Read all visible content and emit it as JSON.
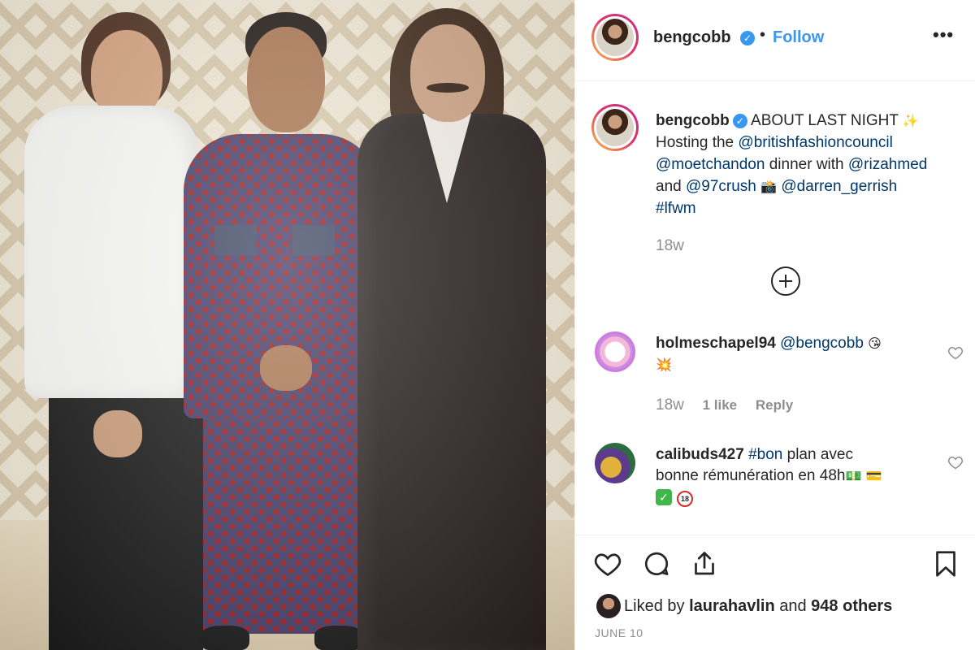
{
  "post": {
    "username": "bengcobb",
    "follow_label": "Follow",
    "more_label": "•••"
  },
  "caption": {
    "username": "bengcobb",
    "text_start": "ABOUT LAST NIGHT",
    "sparkle_emoji": "✨",
    "hosting_the": "Hosting the",
    "mention_bfc": "@britishfashioncouncil",
    "mention_moet": "@moetchandon",
    "dinner_with": "dinner with",
    "mention_riz": "@rizahmed",
    "and_word": "and",
    "mention_97": "@97crush",
    "camera_emoji": "📸",
    "mention_darren": "@darren_gerrish",
    "hashtag": "#lfwm",
    "time": "18w"
  },
  "comments": [
    {
      "username": "holmeschapel94",
      "mention": "@bengcobb",
      "emoji1": "😘",
      "emoji2": "💥",
      "time": "18w",
      "likes": "1 like",
      "reply_label": "Reply"
    },
    {
      "username": "calibuds427",
      "hashtag": "#bon",
      "text1": "plan avec",
      "text2": "bonne rémunération en 48h",
      "emoji_money": "💵",
      "emoji_card": "💳",
      "emoji_check": "✓",
      "emoji_18": "18"
    }
  ],
  "likes": {
    "liked_by": "Liked by",
    "user": "laurahavlin",
    "and_word": "and",
    "others": "948 others"
  },
  "date": "JUNE 10",
  "icons": {
    "like": "heart-icon",
    "comment": "comment-icon",
    "share": "share-icon",
    "save": "bookmark-icon",
    "add_comment": "plus-circle-icon",
    "comment_like": "heart-icon"
  },
  "colors": {
    "link": "#00376b",
    "follow": "#3897f0",
    "muted": "#8e8e8e",
    "text": "#262626"
  }
}
